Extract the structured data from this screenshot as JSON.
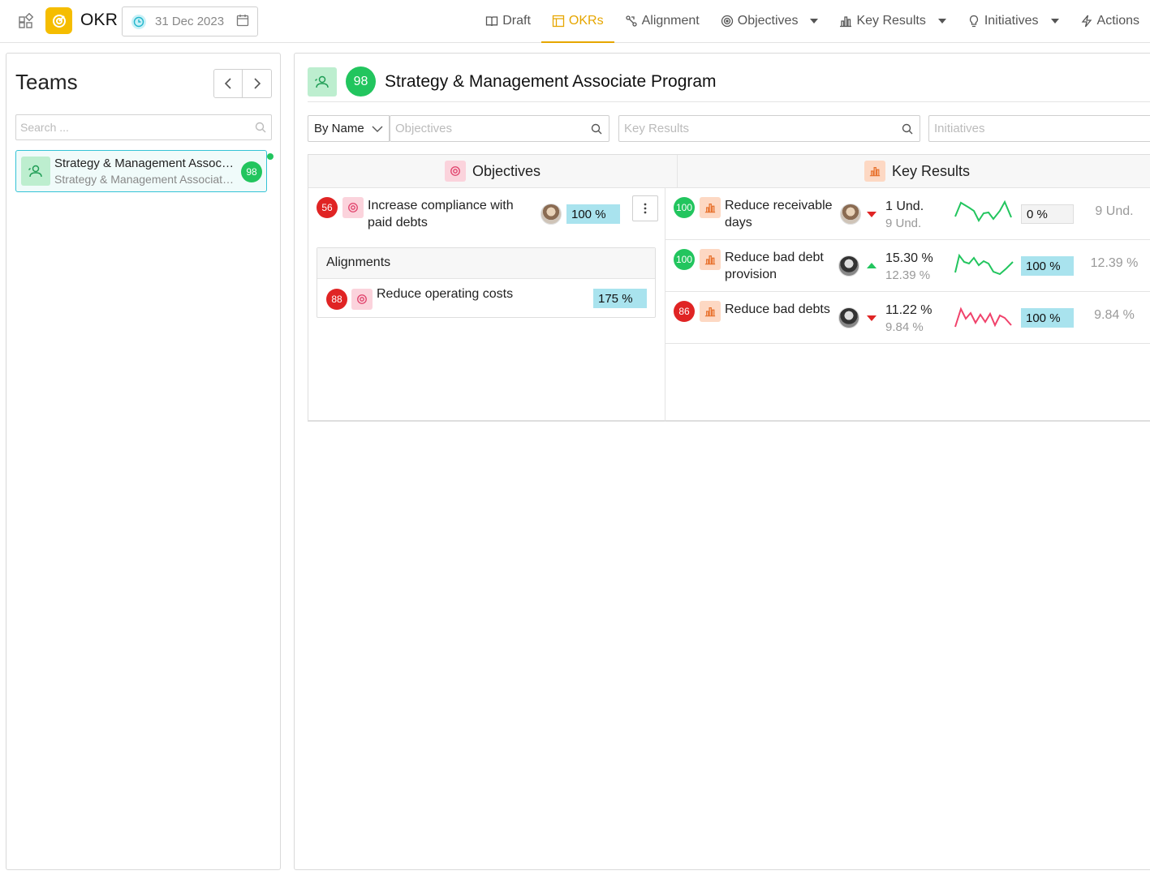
{
  "app": {
    "name": "OKR",
    "date": "31 Dec 2023"
  },
  "nav": [
    {
      "label": "Draft",
      "icon": "book-icon",
      "active": false
    },
    {
      "label": "OKRs",
      "icon": "table-icon",
      "active": true
    },
    {
      "label": "Alignment",
      "icon": "alignment-icon",
      "active": false
    },
    {
      "label": "Objectives",
      "icon": "target-icon",
      "active": false,
      "dropdown": true
    },
    {
      "label": "Key Results",
      "icon": "bar-chart-icon",
      "active": false,
      "dropdown": true
    },
    {
      "label": "Initiatives",
      "icon": "lightbulb-icon",
      "active": false,
      "dropdown": true
    },
    {
      "label": "Actions",
      "icon": "bolt-icon",
      "active": false
    }
  ],
  "teams": {
    "title": "Teams",
    "search_placeholder": "Search ...",
    "items": [
      {
        "name": "Strategy & Management Associate Program",
        "subtitle": "Strategy & Management Associate Program",
        "score": "98"
      }
    ]
  },
  "main": {
    "team_score": "98",
    "team_title": "Strategy & Management Associate Program",
    "sort_label": "By Name",
    "filters": {
      "objectives_placeholder": "Objectives",
      "key_results_placeholder": "Key Results",
      "initiatives_placeholder": "Initiatives"
    },
    "objectives_header": "Objectives",
    "key_results_header": "Key Results",
    "objective": {
      "score": "56",
      "title": "Increase compliance with paid debts",
      "progress": "100 %"
    },
    "alignments": {
      "header": "Alignments",
      "items": [
        {
          "score": "88",
          "title": "Reduce operating costs",
          "progress": "175 %"
        }
      ]
    },
    "key_results": [
      {
        "score": "100",
        "score_color": "green",
        "title": "Reduce receivable days",
        "trend": "down",
        "current": "1 Und.",
        "previous": "9 Und.",
        "progress": "0 %",
        "progress_fraction": 0,
        "target": "9 Und.",
        "spark_color": "#22c55e"
      },
      {
        "score": "100",
        "score_color": "green",
        "title": "Reduce bad debt provision",
        "trend": "up",
        "current": "15.30 %",
        "previous": "12.39 %",
        "progress": "100 %",
        "progress_fraction": 1,
        "target": "12.39 %",
        "spark_color": "#22c55e"
      },
      {
        "score": "86",
        "score_color": "red",
        "title": "Reduce bad debts",
        "trend": "down",
        "current": "11.22 %",
        "previous": "9.84 %",
        "progress": "100 %",
        "progress_fraction": 1,
        "target": "9.84 %",
        "spark_color": "#f0426b"
      }
    ]
  },
  "colors": {
    "accent": "#e6a600",
    "success": "#22c55e",
    "danger": "#e02424",
    "progress": "#a9e3ee",
    "selected_border": "#34c3d6"
  }
}
